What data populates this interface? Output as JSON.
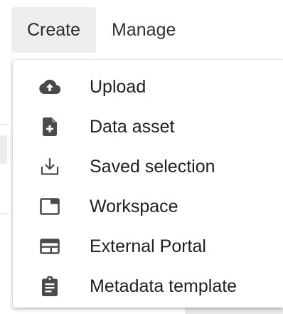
{
  "tabs": {
    "create_label": "Create",
    "manage_label": "Manage"
  },
  "menu": {
    "items": [
      {
        "label": "Upload",
        "icon": "cloud-upload-icon"
      },
      {
        "label": "Data asset",
        "icon": "file-plus-icon"
      },
      {
        "label": "Saved selection",
        "icon": "download-tray-icon"
      },
      {
        "label": "Workspace",
        "icon": "window-icon"
      },
      {
        "label": "External Portal",
        "icon": "portal-card-icon"
      },
      {
        "label": "Metadata template",
        "icon": "clipboard-icon"
      }
    ]
  },
  "colors": {
    "icon": "#4a4a4a",
    "active_tab_bg": "#eeeeee",
    "text": "#202020"
  }
}
